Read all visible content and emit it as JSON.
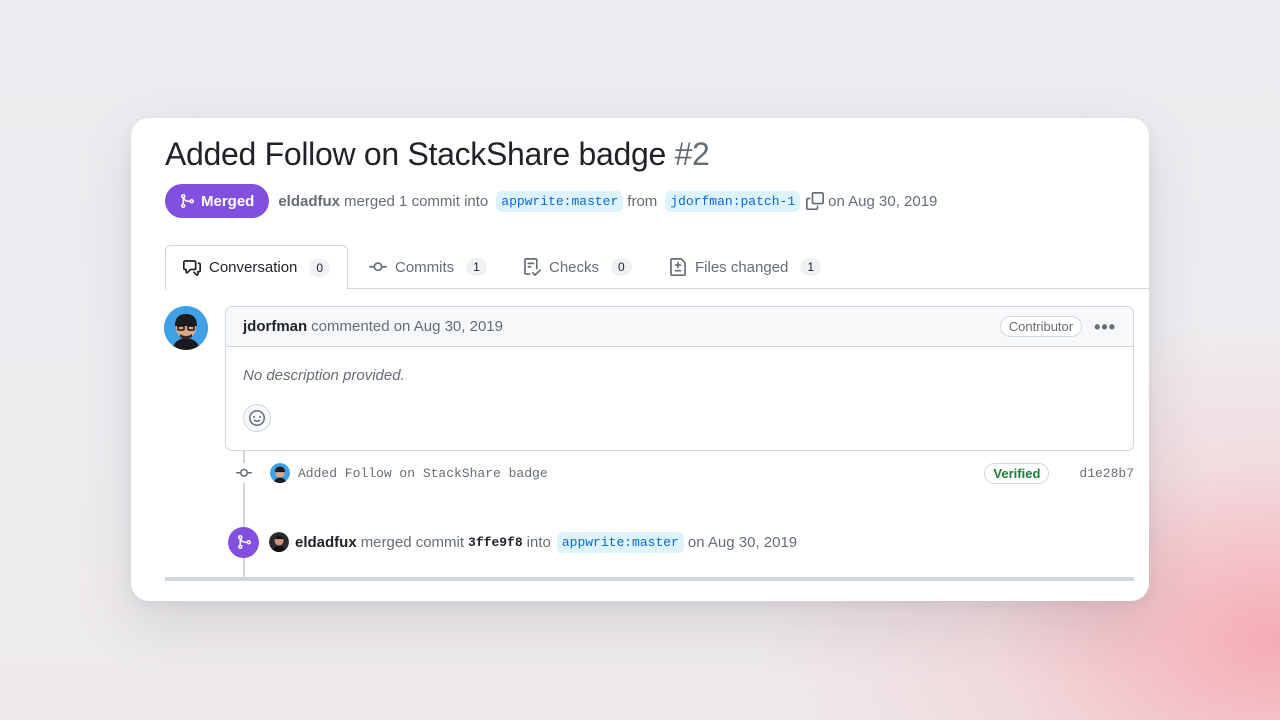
{
  "pr": {
    "title": "Added Follow on StackShare badge",
    "number": "#2",
    "state_label": "Merged",
    "merged_by": "eldadfux",
    "merged_text": "merged 1 commit into",
    "base_branch": "appwrite:master",
    "from_text": "from",
    "head_branch": "jdorfman:patch-1",
    "date_text": "on Aug 30, 2019"
  },
  "tabs": [
    {
      "label": "Conversation",
      "count": "0",
      "icon": "conversation-icon"
    },
    {
      "label": "Commits",
      "count": "1",
      "icon": "commit-icon"
    },
    {
      "label": "Checks",
      "count": "0",
      "icon": "checklist-icon"
    },
    {
      "label": "Files changed",
      "count": "1",
      "icon": "file-diff-icon"
    }
  ],
  "comment": {
    "author": "jdorfman",
    "action": "commented on Aug 30, 2019",
    "role_badge": "Contributor",
    "body": "No description provided."
  },
  "commit": {
    "message": "Added Follow on StackShare badge",
    "status": "Verified",
    "sha": "d1e28b7"
  },
  "merge_event": {
    "user": "eldadfux",
    "action": "merged commit",
    "sha": "3ffe9f8",
    "into_text": "into",
    "branch": "appwrite:master",
    "date_text": "on Aug 30, 2019"
  },
  "colors": {
    "merged": "#8250df",
    "link": "#0969da",
    "verified": "#1a7f37"
  }
}
